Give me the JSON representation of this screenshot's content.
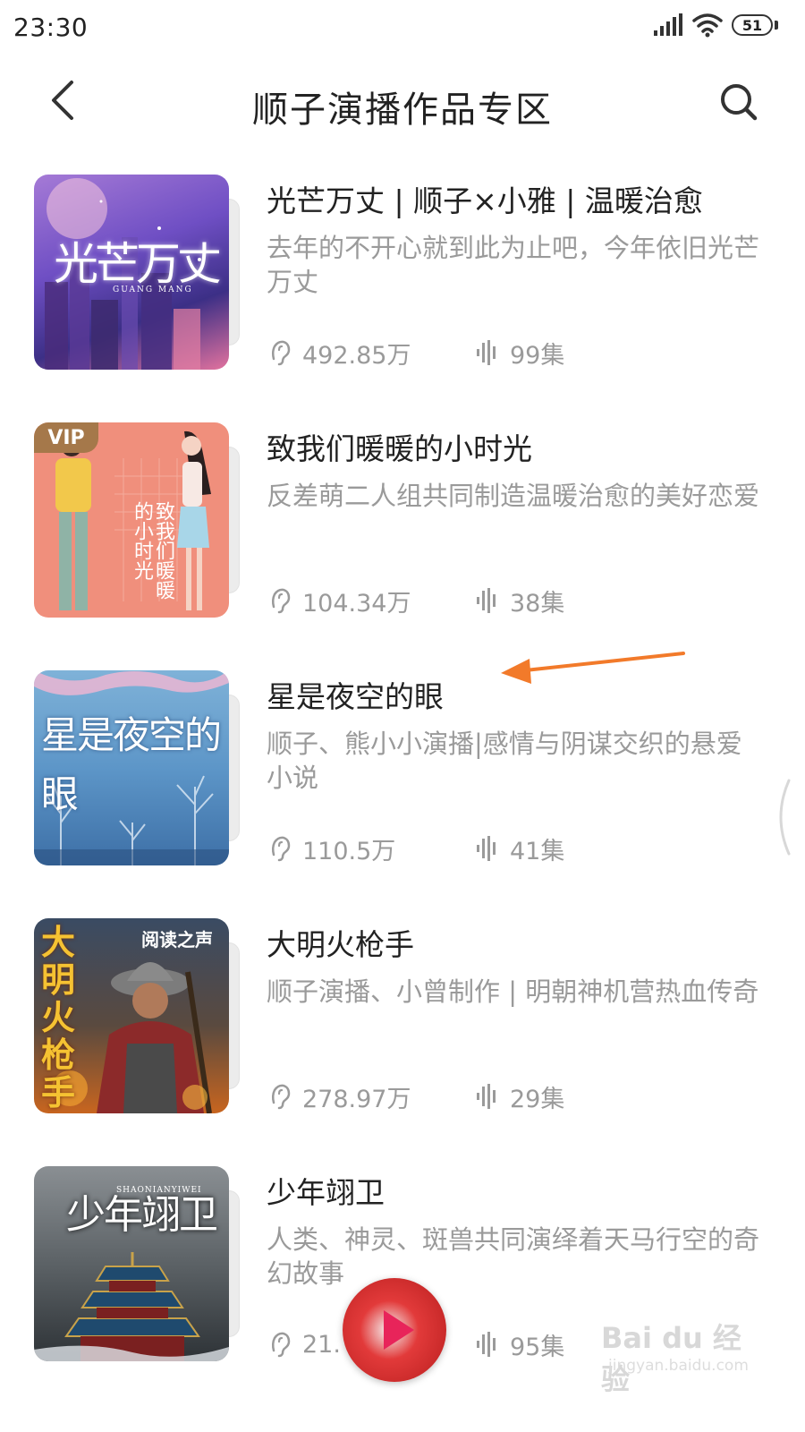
{
  "status_bar": {
    "time": "23:30",
    "battery": "51"
  },
  "header": {
    "title": "顺子演播作品专区"
  },
  "books": [
    {
      "title": "光芒万丈 | 顺子×小雅 | 温暖治愈",
      "description": "去年的不开心就到此为止吧，今年依旧光芒万丈",
      "plays": "492.85万",
      "episodes": "99集",
      "cover_text": "光芒万丈",
      "cover_subtext": "GUANG MANG",
      "vip": ""
    },
    {
      "title": "致我们暖暖的小时光",
      "description": "反差萌二人组共同制造温暖治愈的美好恋爱",
      "plays": "104.34万",
      "episodes": "38集",
      "cover_text": "致我们暖暖的小时光",
      "cover_subtext": "",
      "vip": "VIP"
    },
    {
      "title": "星是夜空的眼",
      "description": "顺子、熊小小演播|感情与阴谋交织的悬爱小说",
      "plays": "110.5万",
      "episodes": "41集",
      "cover_text": "星是夜空的眼",
      "cover_subtext": "",
      "vip": ""
    },
    {
      "title": "大明火枪手",
      "description": "顺子演播、小曾制作 | 明朝神机营热血传奇",
      "plays": "278.97万",
      "episodes": "29集",
      "cover_text": "大明火枪手",
      "cover_subtext": "阅读之声",
      "vip": ""
    },
    {
      "title": "少年翊卫",
      "description": "人类、神灵、斑兽共同演绎着天马行空的奇幻故事",
      "plays": "21.",
      "episodes": "95集",
      "cover_text": "少年翊卫",
      "cover_subtext": "SHAONIANYIWEI",
      "vip": ""
    }
  ],
  "watermark": {
    "main": "Bai du 经验",
    "sub": "jingyan.baidu.com"
  },
  "icons": {
    "plays": "headphone-icon",
    "episodes": "waveform-icon",
    "back": "chevron-left-icon",
    "search": "search-icon"
  },
  "colors": {
    "annotation_arrow": "#f27a2a",
    "muted_text": "#9a9a9a"
  }
}
